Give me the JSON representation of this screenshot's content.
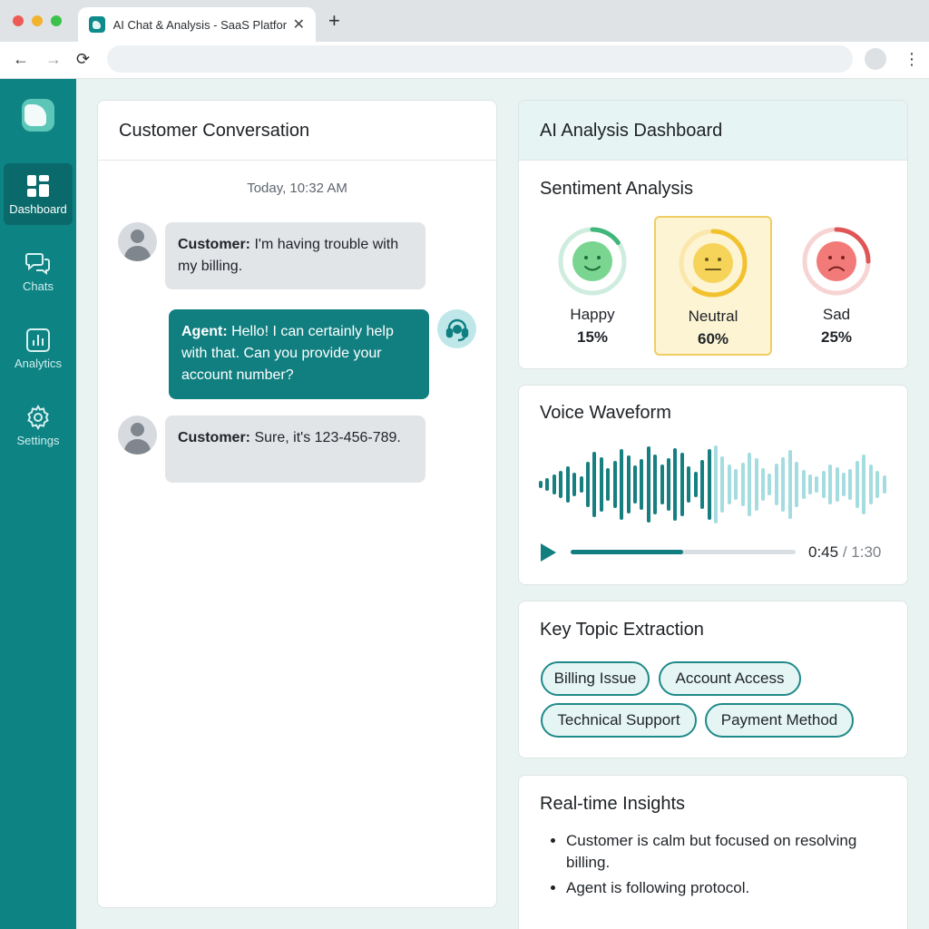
{
  "browser": {
    "tab_title": "AI Chat & Analysis - SaaS Platform",
    "url": "",
    "new_tab_label": "+"
  },
  "sidebar": {
    "items": [
      {
        "label": "Dashboard",
        "icon": "dashboard-icon",
        "active": true
      },
      {
        "label": "Chats",
        "icon": "chats-icon",
        "active": false
      },
      {
        "label": "Analytics",
        "icon": "analytics-icon",
        "active": false
      },
      {
        "label": "Settings",
        "icon": "gear-icon",
        "active": false
      }
    ]
  },
  "conversation": {
    "title": "Customer Conversation",
    "timestamp": "Today, 10:32 AM",
    "messages": [
      {
        "speaker": "Customer:",
        "text": " I'm having trouble with my billing."
      },
      {
        "speaker": "Agent:",
        "text": " Hello! I can certainly help with that. Can you provide your account number?"
      },
      {
        "speaker": "Customer:",
        "text": " Sure, it's 123-456-789."
      }
    ]
  },
  "analysis": {
    "title": "AI Analysis Dashboard",
    "sentiment": {
      "title": "Sentiment Analysis",
      "items": [
        {
          "label": "Happy",
          "percent": "15%",
          "value": 15,
          "icon": "happy-face-icon",
          "color": "#3fb67a",
          "face": "#79d58f"
        },
        {
          "label": "Neutral",
          "percent": "60%",
          "value": 60,
          "icon": "neutral-face-icon",
          "color": "#f2c12e",
          "face": "#f6d45a"
        },
        {
          "label": "Sad",
          "percent": "25%",
          "value": 25,
          "icon": "sad-face-icon",
          "color": "#e05555",
          "face": "#f27a78"
        }
      ]
    },
    "waveform": {
      "title": "Voice Waveform",
      "current_time": "0:45",
      "separator": " / ",
      "total_time": "1:30",
      "progress": 0.5,
      "played_color": "#177f80",
      "unplayed_color": "#a5dcdf"
    },
    "topics": {
      "title": "Key Topic Extraction",
      "chips": [
        "Billing Issue",
        "Account Access",
        "Technical Support",
        "Payment Method"
      ]
    },
    "insights": {
      "title": "Real-time Insights",
      "items": [
        "Customer is calm but focused on resolving billing.",
        "Agent is following protocol."
      ]
    }
  }
}
